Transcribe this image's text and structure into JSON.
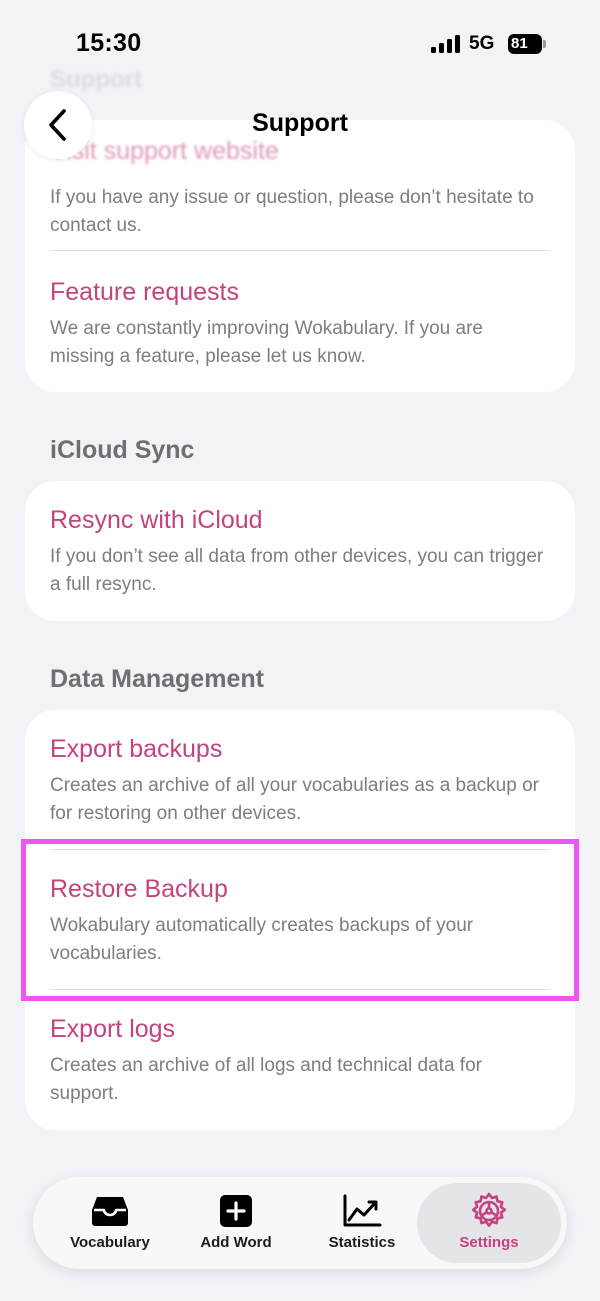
{
  "status_bar": {
    "time": "15:30",
    "network": "5G",
    "battery": "81"
  },
  "ghost_header": "Support",
  "nav": {
    "title": "Support"
  },
  "support_card": {
    "faded_title": "Visit support website",
    "items": [
      {
        "title": "",
        "description": "If you have any issue or question, please don’t hesitate to contact us."
      },
      {
        "title": "Feature requests",
        "description": "We are constantly improving Wokabulary. If you are missing a feature, please let us know."
      }
    ]
  },
  "icloud_section": {
    "header": "iCloud Sync",
    "items": [
      {
        "title": "Resync with iCloud",
        "description": "If you don’t see all data from other devices, you can trigger a full resync."
      }
    ]
  },
  "data_section": {
    "header": "Data Management",
    "items": [
      {
        "title": "Export backups",
        "description": "Creates an archive of all your vocabularies as a backup or for restoring on other devices."
      },
      {
        "title": "Restore Backup",
        "description": "Wokabulary automatically creates backups of your vocabularies."
      },
      {
        "title": "Export logs",
        "description": "Creates an archive of all logs and technical data for support."
      }
    ]
  },
  "tab_bar": {
    "tabs": [
      {
        "label": "Vocabulary",
        "icon": "tray-icon"
      },
      {
        "label": "Add Word",
        "icon": "plus-square-icon"
      },
      {
        "label": "Statistics",
        "icon": "chart-icon"
      },
      {
        "label": "Settings",
        "icon": "gear-icon",
        "active": true
      }
    ]
  },
  "colors": {
    "accent": "#c4427e",
    "highlight": "#ee55ee",
    "background": "#f2f2f7"
  }
}
